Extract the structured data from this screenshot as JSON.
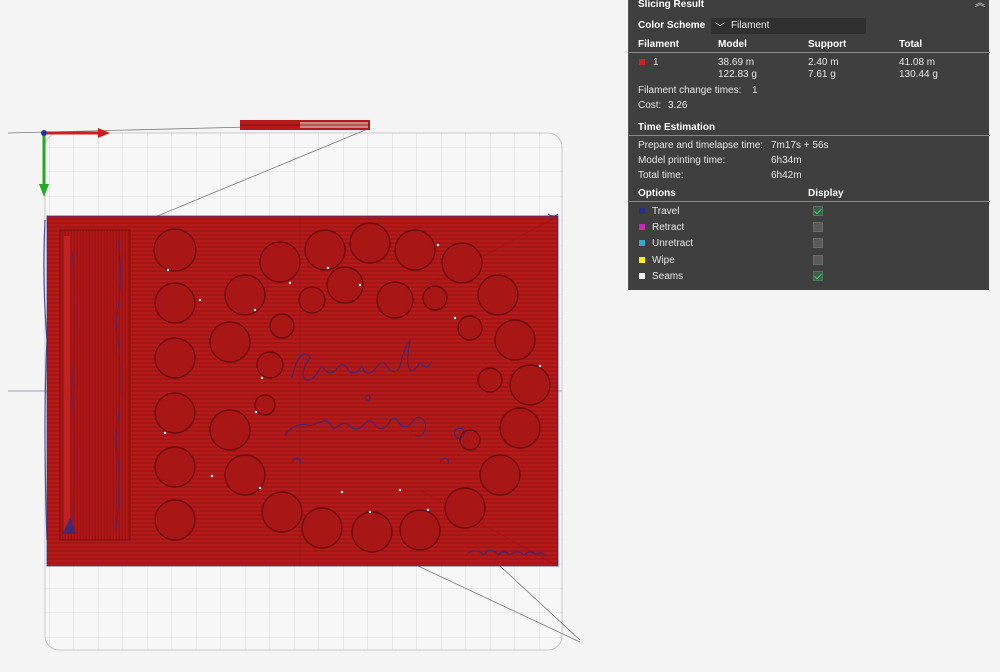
{
  "panel": {
    "title": "Slicing Result",
    "color_scheme_label": "Color Scheme",
    "color_scheme_value": "Filament",
    "headers": {
      "filament": "Filament",
      "model": "Model",
      "support": "Support",
      "total": "Total"
    },
    "filament_row": {
      "index": "1",
      "color": "#d02020",
      "model_length": "38.69 m",
      "model_weight": "122.83 g",
      "support_length": "2.40 m",
      "support_weight": "7.61 g",
      "total_length": "41.08 m",
      "total_weight": "130.44 g"
    },
    "filament_change_label": "Filament change times:",
    "filament_change_value": "1",
    "cost_label": "Cost:",
    "cost_value": "3.26",
    "time_estimation_title": "Time Estimation",
    "prepare_label": "Prepare and timelapse time:",
    "prepare_value": "7m17s + 56s",
    "model_time_label": "Model printing time:",
    "model_time_value": "6h34m",
    "total_time_label": "Total time:",
    "total_time_value": "6h42m",
    "options_header": "Options",
    "display_header": "Display",
    "options": [
      {
        "label": "Travel",
        "color": "#2a2a9a",
        "checked": true
      },
      {
        "label": "Retract",
        "color": "#cc22cc",
        "checked": false
      },
      {
        "label": "Unretract",
        "color": "#33aacc",
        "checked": false
      },
      {
        "label": "Wipe",
        "color": "#ffee00",
        "checked": false
      },
      {
        "label": "Seams",
        "color": "#eeeeee",
        "checked": true
      }
    ]
  },
  "model": {
    "base_color": "#b51a1a",
    "travel_color": "#2a2a8a"
  }
}
